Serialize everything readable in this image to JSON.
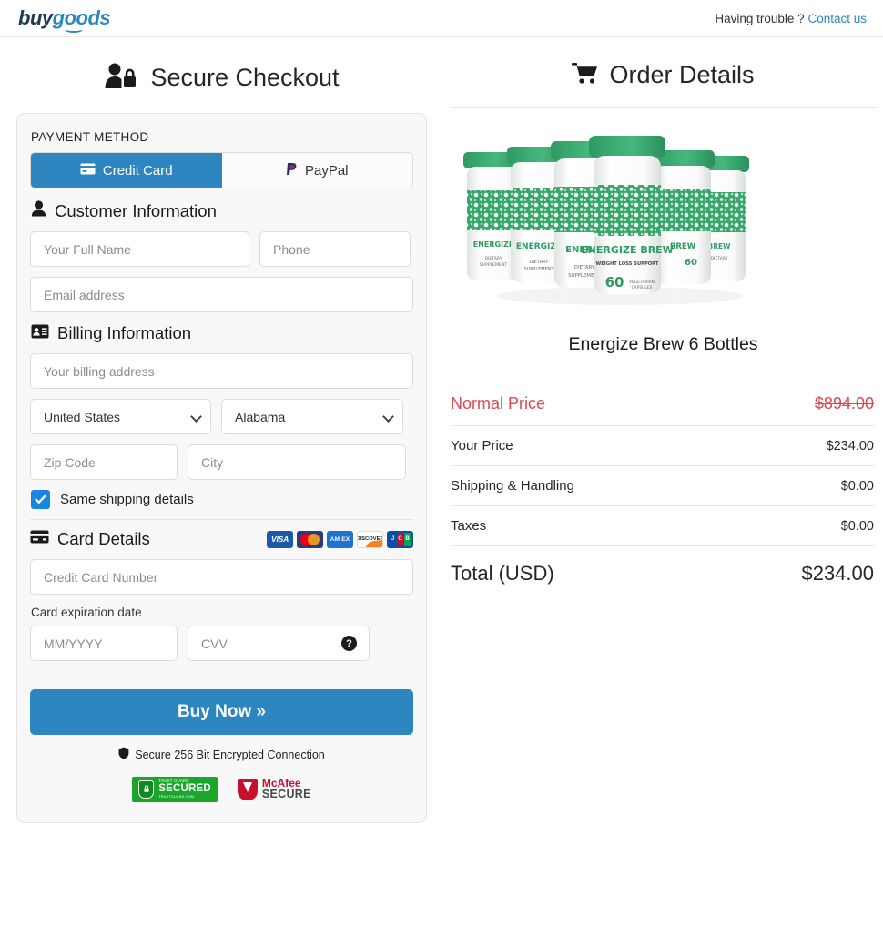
{
  "header": {
    "logo_buy": "buy",
    "logo_goods": "goods",
    "help_text": "Having trouble ?",
    "help_link": "Contact us"
  },
  "left": {
    "title": "Secure Checkout",
    "payment_method_label": "PAYMENT METHOD",
    "tabs": [
      {
        "label": "Credit Card",
        "active": true
      },
      {
        "label": "PayPal",
        "active": false
      }
    ],
    "customer_section": {
      "title": "Customer Information",
      "full_name_placeholder": "Your Full Name",
      "phone_placeholder": "Phone",
      "email_placeholder": "Email address"
    },
    "billing_section": {
      "title": "Billing Information",
      "address_placeholder": "Your billing address",
      "country_value": "United States",
      "state_value": "Alabama",
      "zip_placeholder": "Zip Code",
      "city_placeholder": "City",
      "same_shipping_label": "Same shipping details"
    },
    "card_section": {
      "title": "Card Details",
      "brands": [
        "VISA",
        "Mastercard",
        "AM EX",
        "DISCOVER",
        "JCB"
      ],
      "card_number_placeholder": "Credit Card Number",
      "expiration_label": "Card expiration date",
      "expiration_placeholder": "MM/YYYY",
      "cvv_placeholder": "CVV",
      "cvv_help": "?"
    },
    "buy_button": "Buy Now »",
    "secure_note": "Secure 256 Bit Encrypted Connection",
    "badges": {
      "trustguard_top": "TRUST GUARD",
      "trustguard_main": "SECURED",
      "trustguard_bottom": "TRUSTGUARD.COM",
      "mcafee_top": "McAfee",
      "mcafee_bottom": "SECURE"
    }
  },
  "right": {
    "title": "Order Details",
    "product_name": "Energize Brew 6 Bottles",
    "product_label_brand": "ENERGIZE BREW",
    "product_label_sub": "WEIGHT LOSS SUPPORT",
    "product_label_count": "60",
    "product_label_count_sub": "VEGETARIAN CAPSULES",
    "product_label_diet": "DIETARY SUPPLEMENT",
    "summary": [
      {
        "key": "Normal Price",
        "value": "$894.00",
        "style": "normal"
      },
      {
        "key": "Your Price",
        "value": "$234.00",
        "style": "plain"
      },
      {
        "key": "Shipping & Handling",
        "value": "$0.00",
        "style": "plain"
      },
      {
        "key": "Taxes",
        "value": "$0.00",
        "style": "plain"
      },
      {
        "key": "Total (USD)",
        "value": "$234.00",
        "style": "total"
      }
    ]
  },
  "colors": {
    "accent_blue": "#2e86c1",
    "sale_red": "#e0464f",
    "checkbox_blue": "#1a84e2",
    "bottle_green": "#3aa76d"
  }
}
